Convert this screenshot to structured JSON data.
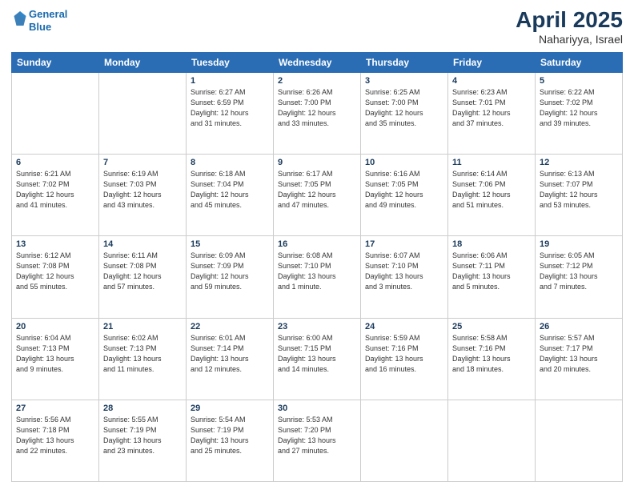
{
  "header": {
    "logo_line1": "General",
    "logo_line2": "Blue",
    "month": "April 2025",
    "location": "Nahariyya, Israel"
  },
  "weekdays": [
    "Sunday",
    "Monday",
    "Tuesday",
    "Wednesday",
    "Thursday",
    "Friday",
    "Saturday"
  ],
  "weeks": [
    [
      {
        "day": "",
        "info": ""
      },
      {
        "day": "",
        "info": ""
      },
      {
        "day": "1",
        "info": "Sunrise: 6:27 AM\nSunset: 6:59 PM\nDaylight: 12 hours\nand 31 minutes."
      },
      {
        "day": "2",
        "info": "Sunrise: 6:26 AM\nSunset: 7:00 PM\nDaylight: 12 hours\nand 33 minutes."
      },
      {
        "day": "3",
        "info": "Sunrise: 6:25 AM\nSunset: 7:00 PM\nDaylight: 12 hours\nand 35 minutes."
      },
      {
        "day": "4",
        "info": "Sunrise: 6:23 AM\nSunset: 7:01 PM\nDaylight: 12 hours\nand 37 minutes."
      },
      {
        "day": "5",
        "info": "Sunrise: 6:22 AM\nSunset: 7:02 PM\nDaylight: 12 hours\nand 39 minutes."
      }
    ],
    [
      {
        "day": "6",
        "info": "Sunrise: 6:21 AM\nSunset: 7:02 PM\nDaylight: 12 hours\nand 41 minutes."
      },
      {
        "day": "7",
        "info": "Sunrise: 6:19 AM\nSunset: 7:03 PM\nDaylight: 12 hours\nand 43 minutes."
      },
      {
        "day": "8",
        "info": "Sunrise: 6:18 AM\nSunset: 7:04 PM\nDaylight: 12 hours\nand 45 minutes."
      },
      {
        "day": "9",
        "info": "Sunrise: 6:17 AM\nSunset: 7:05 PM\nDaylight: 12 hours\nand 47 minutes."
      },
      {
        "day": "10",
        "info": "Sunrise: 6:16 AM\nSunset: 7:05 PM\nDaylight: 12 hours\nand 49 minutes."
      },
      {
        "day": "11",
        "info": "Sunrise: 6:14 AM\nSunset: 7:06 PM\nDaylight: 12 hours\nand 51 minutes."
      },
      {
        "day": "12",
        "info": "Sunrise: 6:13 AM\nSunset: 7:07 PM\nDaylight: 12 hours\nand 53 minutes."
      }
    ],
    [
      {
        "day": "13",
        "info": "Sunrise: 6:12 AM\nSunset: 7:08 PM\nDaylight: 12 hours\nand 55 minutes."
      },
      {
        "day": "14",
        "info": "Sunrise: 6:11 AM\nSunset: 7:08 PM\nDaylight: 12 hours\nand 57 minutes."
      },
      {
        "day": "15",
        "info": "Sunrise: 6:09 AM\nSunset: 7:09 PM\nDaylight: 12 hours\nand 59 minutes."
      },
      {
        "day": "16",
        "info": "Sunrise: 6:08 AM\nSunset: 7:10 PM\nDaylight: 13 hours\nand 1 minute."
      },
      {
        "day": "17",
        "info": "Sunrise: 6:07 AM\nSunset: 7:10 PM\nDaylight: 13 hours\nand 3 minutes."
      },
      {
        "day": "18",
        "info": "Sunrise: 6:06 AM\nSunset: 7:11 PM\nDaylight: 13 hours\nand 5 minutes."
      },
      {
        "day": "19",
        "info": "Sunrise: 6:05 AM\nSunset: 7:12 PM\nDaylight: 13 hours\nand 7 minutes."
      }
    ],
    [
      {
        "day": "20",
        "info": "Sunrise: 6:04 AM\nSunset: 7:13 PM\nDaylight: 13 hours\nand 9 minutes."
      },
      {
        "day": "21",
        "info": "Sunrise: 6:02 AM\nSunset: 7:13 PM\nDaylight: 13 hours\nand 11 minutes."
      },
      {
        "day": "22",
        "info": "Sunrise: 6:01 AM\nSunset: 7:14 PM\nDaylight: 13 hours\nand 12 minutes."
      },
      {
        "day": "23",
        "info": "Sunrise: 6:00 AM\nSunset: 7:15 PM\nDaylight: 13 hours\nand 14 minutes."
      },
      {
        "day": "24",
        "info": "Sunrise: 5:59 AM\nSunset: 7:16 PM\nDaylight: 13 hours\nand 16 minutes."
      },
      {
        "day": "25",
        "info": "Sunrise: 5:58 AM\nSunset: 7:16 PM\nDaylight: 13 hours\nand 18 minutes."
      },
      {
        "day": "26",
        "info": "Sunrise: 5:57 AM\nSunset: 7:17 PM\nDaylight: 13 hours\nand 20 minutes."
      }
    ],
    [
      {
        "day": "27",
        "info": "Sunrise: 5:56 AM\nSunset: 7:18 PM\nDaylight: 13 hours\nand 22 minutes."
      },
      {
        "day": "28",
        "info": "Sunrise: 5:55 AM\nSunset: 7:19 PM\nDaylight: 13 hours\nand 23 minutes."
      },
      {
        "day": "29",
        "info": "Sunrise: 5:54 AM\nSunset: 7:19 PM\nDaylight: 13 hours\nand 25 minutes."
      },
      {
        "day": "30",
        "info": "Sunrise: 5:53 AM\nSunset: 7:20 PM\nDaylight: 13 hours\nand 27 minutes."
      },
      {
        "day": "",
        "info": ""
      },
      {
        "day": "",
        "info": ""
      },
      {
        "day": "",
        "info": ""
      }
    ]
  ]
}
